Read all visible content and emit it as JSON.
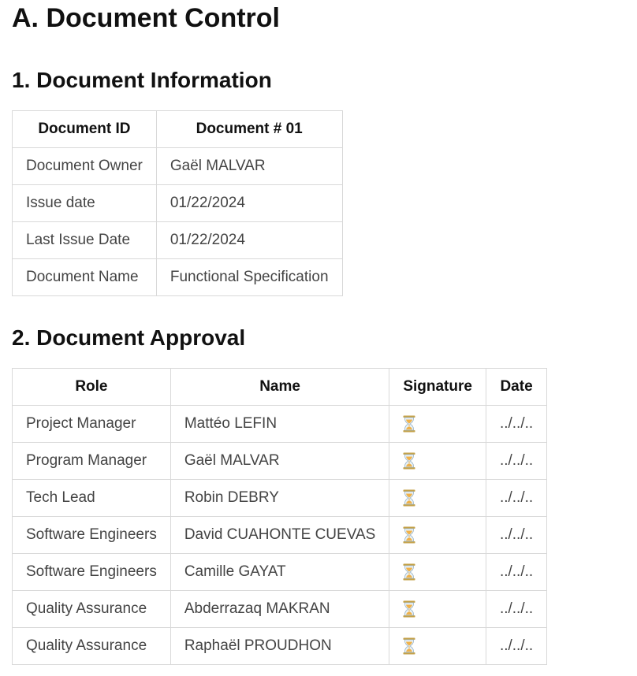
{
  "page": {
    "title": "A. Document Control"
  },
  "info": {
    "heading": "1. Document Information",
    "header": [
      "Document ID",
      "Document # 01"
    ],
    "rows": [
      [
        "Document Owner",
        "Gaël MALVAR"
      ],
      [
        "Issue date",
        "01/22/2024"
      ],
      [
        "Last Issue Date",
        "01/22/2024"
      ],
      [
        "Document Name",
        "Functional Specification"
      ]
    ]
  },
  "approval": {
    "heading": "2. Document Approval",
    "header": [
      "Role",
      "Name",
      "Signature",
      "Date"
    ],
    "signature_icon": "hourglass-icon",
    "rows": [
      {
        "role": "Project Manager",
        "name": "Mattéo LEFIN",
        "date": "../../.."
      },
      {
        "role": "Program Manager",
        "name": "Gaël MALVAR",
        "date": "../../.."
      },
      {
        "role": "Tech Lead",
        "name": "Robin DEBRY",
        "date": "../../.."
      },
      {
        "role": "Software Engineers",
        "name": "David CUAHONTE CUEVAS",
        "date": "../../.."
      },
      {
        "role": "Software Engineers",
        "name": "Camille GAYAT",
        "date": "../../.."
      },
      {
        "role": "Quality Assurance",
        "name": "Abderrazaq MAKRAN",
        "date": "../../.."
      },
      {
        "role": "Quality Assurance",
        "name": "Raphaël PROUDHON",
        "date": "../../.."
      }
    ]
  },
  "colors": {
    "border": "#d9d9d9",
    "heading": "#111111",
    "cell_text": "#444444",
    "hourglass_frame": "#c4a24a",
    "hourglass_sand": "#f0b24a"
  }
}
